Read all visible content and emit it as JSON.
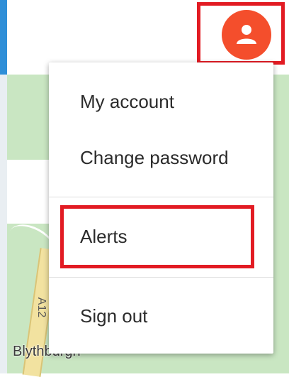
{
  "map": {
    "place_label": "Blythburgh",
    "road_label": "A12"
  },
  "header": {
    "avatar_icon": "user-icon",
    "accent_color": "#f44e2c",
    "highlight_color": "#e21b23"
  },
  "account_menu": {
    "items": [
      {
        "label": "My account"
      },
      {
        "label": "Change password"
      },
      {
        "label": "Alerts"
      },
      {
        "label": "Sign out"
      }
    ]
  }
}
